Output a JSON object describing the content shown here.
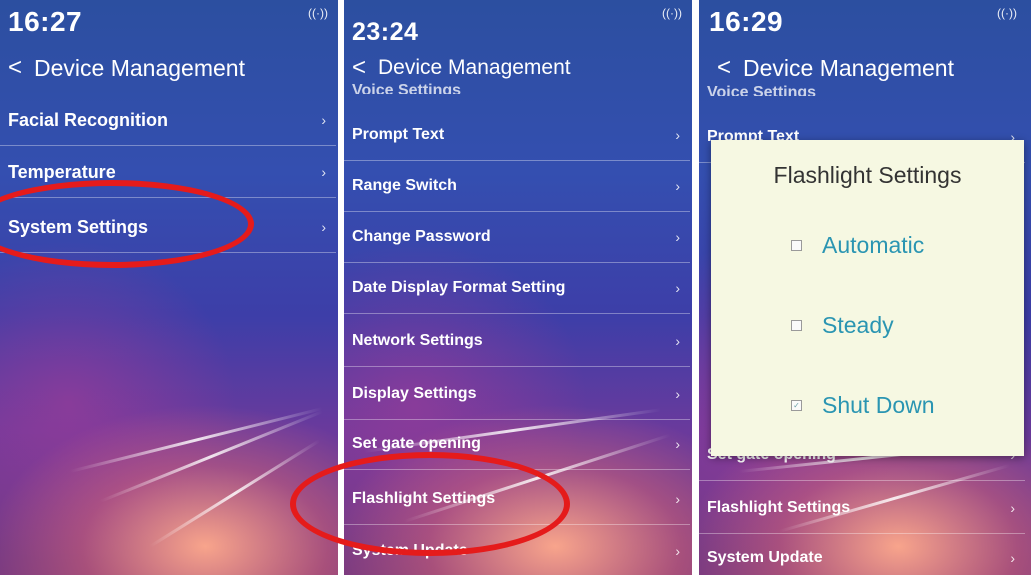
{
  "panels": [
    {
      "time": "16:27",
      "title": "Device Management",
      "items": [
        {
          "label": "Facial Recognition"
        },
        {
          "label": "Temperature"
        },
        {
          "label": "System Settings"
        }
      ]
    },
    {
      "time": "23:24",
      "title": "Device Management",
      "top_cut": "Voice Settings",
      "items": [
        {
          "label": "Prompt Text"
        },
        {
          "label": "Range Switch"
        },
        {
          "label": "Change Password"
        },
        {
          "label": "Date Display Format Setting"
        },
        {
          "label": "Network Settings"
        },
        {
          "label": "Display Settings"
        },
        {
          "label": "Set gate opening"
        },
        {
          "label": "Flashlight Settings"
        },
        {
          "label": "System Update"
        }
      ]
    },
    {
      "time": "16:29",
      "title": "Device Management",
      "top_cut": "Voice Settings",
      "items": [
        {
          "label": "Prompt Text"
        },
        {
          "label": "Set gate opening"
        },
        {
          "label": "Flashlight Settings"
        },
        {
          "label": "System Update"
        }
      ],
      "dialog": {
        "title": "Flashlight Settings",
        "options": [
          {
            "label": "Automatic",
            "checked": false
          },
          {
            "label": "Steady",
            "checked": false
          },
          {
            "label": "Shut Down",
            "checked": true
          }
        ]
      }
    }
  ],
  "icons": {
    "back": "back-chevron-icon",
    "signal": "signal-antenna-icon",
    "chevron": "chevron-right-icon"
  },
  "colors": {
    "highlight_circle": "#e51b1b",
    "dialog_bg": "#f6f8e2",
    "option_text": "#2a95b2"
  }
}
